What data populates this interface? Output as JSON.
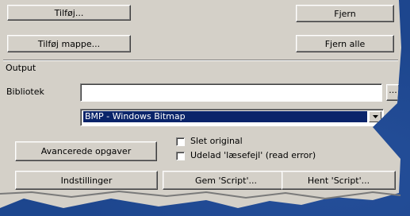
{
  "files_buttons": {
    "add": "Tilføj...",
    "add_folder": "Tilføj mappe...",
    "remove": "Fjern",
    "remove_all": "Fjern alle"
  },
  "output": {
    "group_label": "Output",
    "library_label": "Bibliotek",
    "library_value": "",
    "browse_label": "...",
    "format_selected": "BMP - Windows Bitmap"
  },
  "options": {
    "advanced_label": "Avancerede opgaver",
    "delete_original_label": "Slet original",
    "delete_original_checked": false,
    "skip_read_error_label": "Udelad 'læsefejl' (read error)",
    "skip_read_error_checked": false
  },
  "bottom_buttons": {
    "settings": "Indstillinger",
    "save_script": "Gem 'Script'...",
    "load_script": "Hent 'Script'..."
  },
  "colors": {
    "panel": "#d4d0c8",
    "background": "#1f4a93",
    "selection": "#0a246a"
  }
}
